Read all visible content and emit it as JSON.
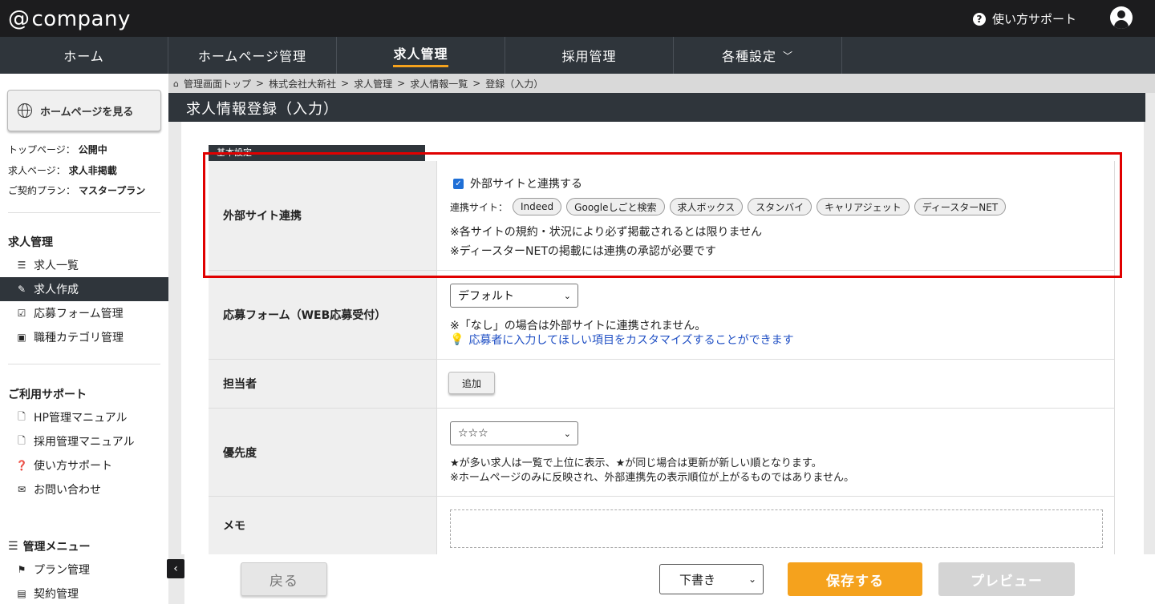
{
  "header": {
    "logo_at": "@",
    "logo_text": "company",
    "help_label": "使い方サポート"
  },
  "nav": {
    "items": [
      {
        "label": "ホーム"
      },
      {
        "label": "ホームページ管理"
      },
      {
        "label": "求人管理"
      },
      {
        "label": "採用管理"
      },
      {
        "label": "各種設定"
      }
    ],
    "active_index": 2
  },
  "sidebar": {
    "view_homepage_label": "ホームページを見る",
    "status": [
      {
        "label": "トップページ：",
        "value": "公開中"
      },
      {
        "label": "求人ページ：",
        "value": "求人非掲載"
      },
      {
        "label": "ご契約プラン：",
        "value": "マスタープラン"
      }
    ],
    "section_jobs": "求人管理",
    "jobs_items": [
      {
        "label": "求人一覧",
        "icon": "list-icon"
      },
      {
        "label": "求人作成",
        "icon": "edit-icon"
      },
      {
        "label": "応募フォーム管理",
        "icon": "checkbox-icon"
      },
      {
        "label": "職種カテゴリ管理",
        "icon": "briefcase-icon"
      }
    ],
    "section_support": "ご利用サポート",
    "support_items": [
      {
        "label": "HP管理マニュアル",
        "icon": "pdf-icon"
      },
      {
        "label": "採用管理マニュアル",
        "icon": "pdf-icon"
      },
      {
        "label": "使い方サポート",
        "icon": "question-icon"
      },
      {
        "label": "お問い合わせ",
        "icon": "envelope-icon"
      }
    ],
    "section_admin": "管理メニュー",
    "admin_items": [
      {
        "label": "プラン管理",
        "icon": "flag-icon"
      },
      {
        "label": "契約管理",
        "icon": "document-icon"
      }
    ]
  },
  "breadcrumb": {
    "items": [
      "管理画面トップ",
      "株式会社大新社",
      "求人管理",
      "求人情報一覧"
    ],
    "current": "登録（入力）"
  },
  "page": {
    "title": "求人情報登録（入力）",
    "section_tab": "基本設定"
  },
  "form": {
    "external": {
      "label": "外部サイト連携",
      "checkbox_label": "外部サイトと連携する",
      "checked": true,
      "sites_label": "連携サイト：",
      "sites": [
        "Indeed",
        "Googleしごと検索",
        "求人ボックス",
        "スタンバイ",
        "キャリアジェット",
        "ディースターNET"
      ],
      "note1": "※各サイトの規約・状況により必ず掲載されるとは限りません",
      "note2": "※ディースターNETの掲載には連携の承認が必要です"
    },
    "application_form": {
      "label": "応募フォーム（WEB応募受付）",
      "selected": "デフォルト",
      "note": "※「なし」の場合は外部サイトに連携されません。",
      "link": "応募者に入力してほしい項目をカスタマイズすることができます"
    },
    "staff": {
      "label": "担当者",
      "add_label": "追加"
    },
    "priority": {
      "label": "優先度",
      "selected": "☆☆☆",
      "note1": "★が多い求人は一覧で上位に表示、★が同じ場合は更新が新しい順となります。",
      "note2": "※ホームページのみに反映され、外部連携先の表示順位が上がるものではありません。"
    },
    "memo": {
      "label": "メモ",
      "value": ""
    }
  },
  "actions": {
    "back_label": "戻る",
    "draft_selected": "下書き",
    "save_label": "保存する",
    "preview_label": "プレビュー"
  },
  "colors": {
    "accent": "#f5a21d",
    "nav_bg": "#2f353b",
    "highlight": "#e00000",
    "link": "#1f4fc4"
  }
}
